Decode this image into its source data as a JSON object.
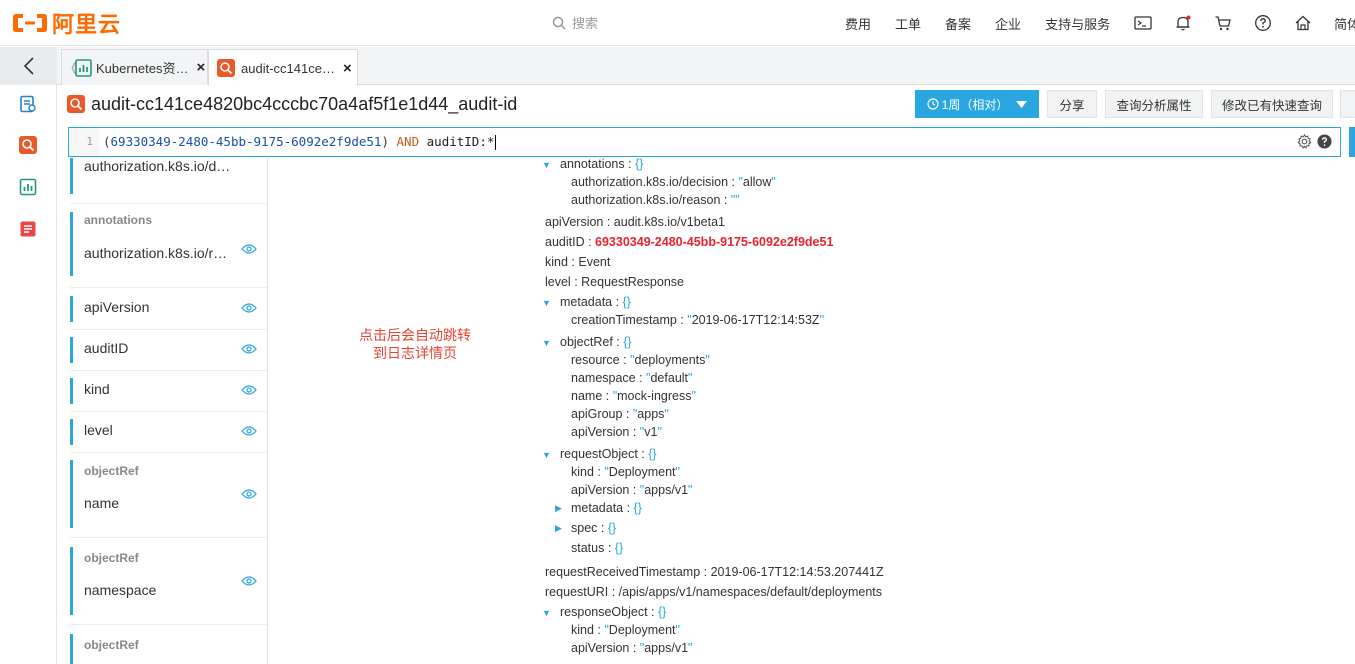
{
  "topbar": {
    "brand": "阿里云",
    "search_placeholder": "搜索",
    "nav": [
      "费用",
      "工单",
      "备案",
      "企业",
      "支持与服务"
    ],
    "lang": "简体中"
  },
  "tabs": [
    {
      "label": "Kubernetes资…",
      "close": "×"
    },
    {
      "label": "audit-cc141ce…",
      "close": "×"
    }
  ],
  "header": {
    "title": "audit-cc141ce4820bc4cccbc70a4af5f1e1d44_audit-id",
    "time_button": "1周（相对）",
    "buttons": [
      "分享",
      "查询分析属性",
      "修改已有快速查询"
    ]
  },
  "query": {
    "line_number": "1",
    "open_paren": "(",
    "id": "69330349-2480-45bb-9175-6092e2f9de51",
    "close_paren": ")",
    "and": "AND",
    "field": "auditID:*"
  },
  "fields": [
    {
      "group": "",
      "name": "authorization.k8s.io/d…"
    },
    {
      "group": "annotations",
      "name": "authorization.k8s.io/r…"
    },
    {
      "group": "",
      "name": "apiVersion"
    },
    {
      "group": "",
      "name": "auditID"
    },
    {
      "group": "",
      "name": "kind"
    },
    {
      "group": "",
      "name": "level"
    },
    {
      "group": "objectRef",
      "name": "name"
    },
    {
      "group": "objectRef",
      "name": "namespace"
    },
    {
      "group": "objectRef",
      "name": ""
    }
  ],
  "annotation_note": [
    "点击后会自动跳转",
    "到日志详情页"
  ],
  "log": {
    "annotations_key": "annotations",
    "decision_key": "authorization.k8s.io/decision",
    "decision_val": "allow",
    "reason_key": "authorization.k8s.io/reason",
    "reason_val": "",
    "apiVersion_key": "apiVersion",
    "apiVersion_val": "audit.k8s.io/v1beta1",
    "auditID_key": "auditID",
    "auditID_val": "69330349-2480-45bb-9175-6092e2f9de51",
    "kind_key": "kind",
    "kind_val": "Event",
    "level_key": "level",
    "level_val": "RequestResponse",
    "metadata_key": "metadata",
    "creationTimestamp_key": "creationTimestamp",
    "creationTimestamp_val": "2019-06-17T12:14:53Z",
    "objectRef_key": "objectRef",
    "resource_key": "resource",
    "resource_val": "deployments",
    "namespace_key": "namespace",
    "namespace_val": "default",
    "name_key": "name",
    "name_val": "mock-ingress",
    "apiGroup_key": "apiGroup",
    "apiGroup_val": "apps",
    "or_apiVersion_key": "apiVersion",
    "or_apiVersion_val": "v1",
    "requestObject_key": "requestObject",
    "ro_kind_key": "kind",
    "ro_kind_val": "Deployment",
    "ro_apiVersion_key": "apiVersion",
    "ro_apiVersion_val": "apps/v1",
    "ro_metadata_key": "metadata",
    "ro_spec_key": "spec",
    "ro_status_key": "status",
    "requestReceivedTimestamp_key": "requestReceivedTimestamp",
    "requestReceivedTimestamp_val": "2019-06-17T12:14:53.207441Z",
    "requestURI_key": "requestURI",
    "requestURI_val": "/apis/apps/v1/namespaces/default/deployments",
    "responseObject_key": "responseObject",
    "resp_kind_key": "kind",
    "resp_kind_val": "Deployment",
    "resp_apiVersion_key": "apiVersion",
    "resp_apiVersion_val": "apps/v1"
  },
  "colors": {
    "accent": "#2aa7e0",
    "brand": "#ff6a00",
    "highlight": "#e8232f"
  }
}
